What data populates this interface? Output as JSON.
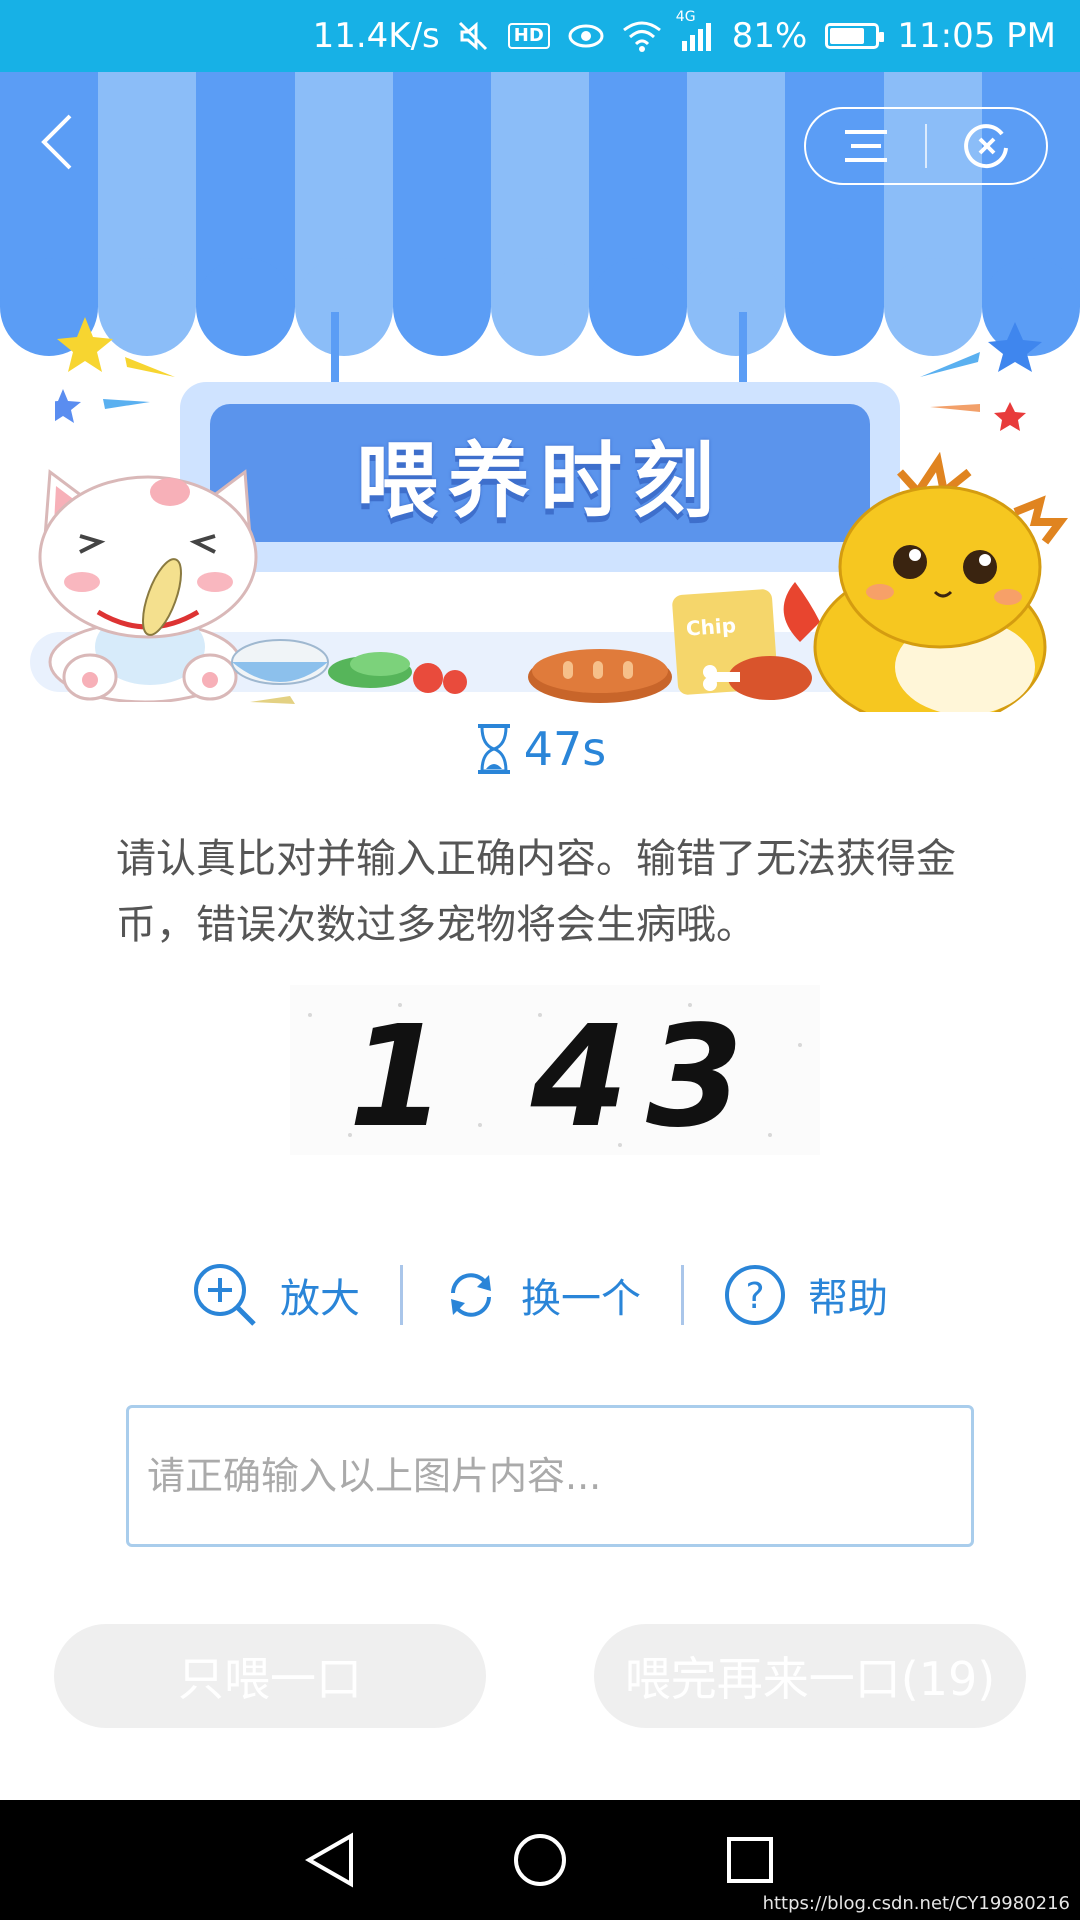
{
  "status_bar": {
    "net_speed": "11.4K/s",
    "hd_badge": "HD",
    "network_type": "4G",
    "battery_percent": "81%",
    "battery_level": 0.81,
    "time": "11:05 PM"
  },
  "header": {
    "sign_title": "喂养时刻",
    "chips_label": "Chip"
  },
  "timer": {
    "value": "47s"
  },
  "instructions": "请认真比对并输入正确内容。输错了无法获得金币，错误次数过多宠物将会生病哦。",
  "captcha": {
    "text": "1 43"
  },
  "tools": {
    "zoom_label": "放大",
    "refresh_label": "换一个",
    "help_label": "帮助"
  },
  "input": {
    "placeholder": "请正确输入以上图片内容..."
  },
  "buttons": {
    "feed_once": "只喂一口",
    "feed_again": "喂完再来一口(19)"
  },
  "watermark": "https://blog.csdn.net/CY19980216",
  "colors": {
    "status_bar": "#17b1e6",
    "accent": "#2a85d8",
    "awning_dark": "#5b9df5",
    "awning_light": "#8bbdf8",
    "button_disabled": "#efefef"
  }
}
